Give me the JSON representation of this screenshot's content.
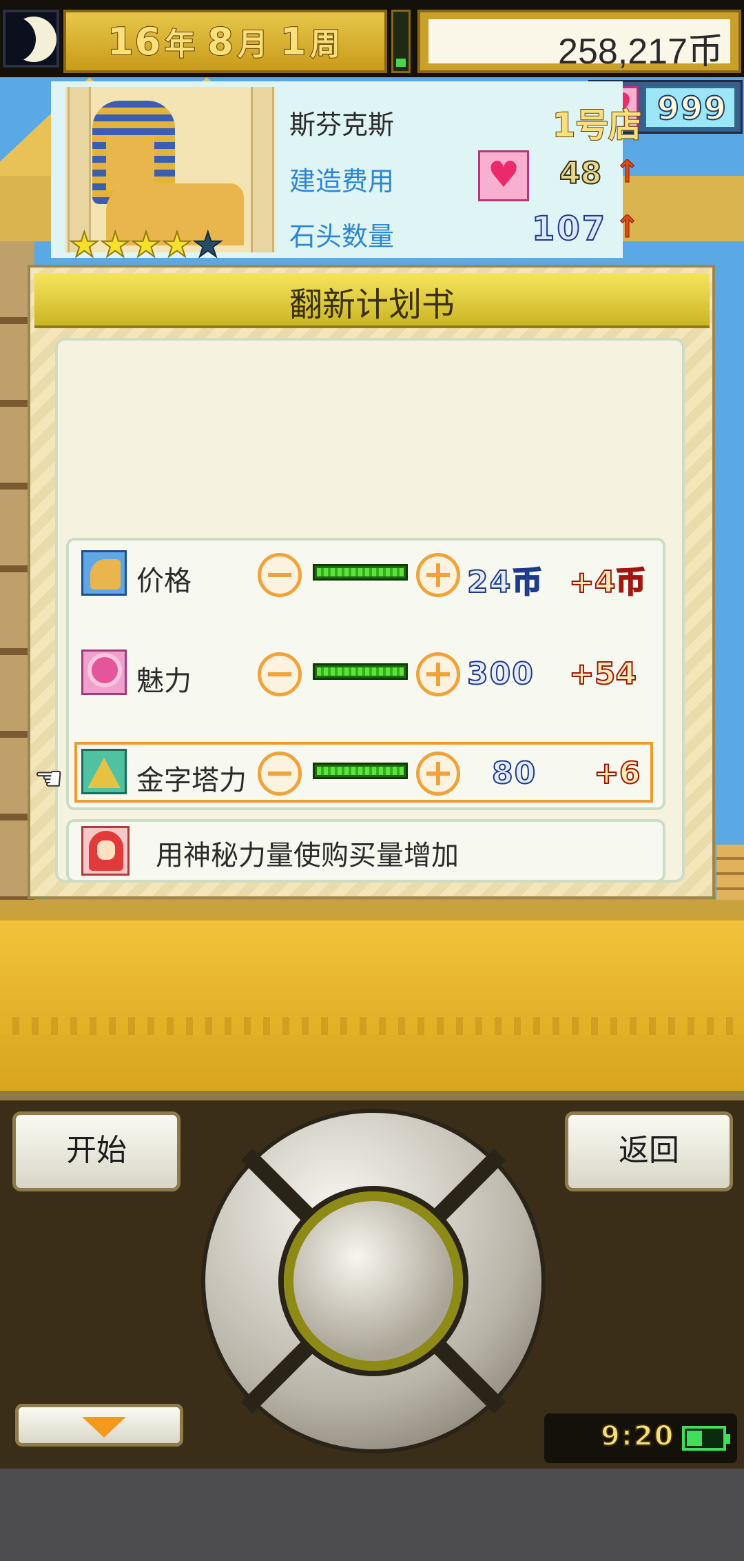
{
  "top_bar": {
    "year": "16",
    "year_unit": "年",
    "month": "8",
    "month_unit": "月",
    "week": "1",
    "week_unit": "周",
    "money": "258,217币"
  },
  "hearts": {
    "count": "999"
  },
  "dialog": {
    "title": "翻新计划书",
    "shop": {
      "name": "斯芬克斯",
      "number": "1号店",
      "stars_filled": 4,
      "stars_total": 5,
      "star_glyph": "★",
      "cost_label": "建造费用",
      "cost_value": "48",
      "stone_label": "石头数量",
      "stone_value": "107",
      "up_arrow": "↑"
    },
    "stats": [
      {
        "label": "价格",
        "value": "24币",
        "delta": "+4币",
        "icon": "sphinx-icon",
        "level": 1.0
      },
      {
        "label": "魅力",
        "value": "300",
        "delta": "+54",
        "icon": "lotus-icon",
        "level": 1.0
      },
      {
        "label": "金字塔力",
        "value": "80",
        "delta": "+6",
        "icon": "pyramid-icon",
        "level": 1.0,
        "selected": true
      }
    ],
    "description": "用神秘力量使购买量增加"
  },
  "controls": {
    "start": "开始",
    "back": "返回",
    "time": "9:20"
  },
  "colors": {
    "dialog_title_bar": "#cab623",
    "accent_orange": "#f0a33a",
    "sky": "#5aa8e6",
    "sand": "#f2c33a"
  }
}
